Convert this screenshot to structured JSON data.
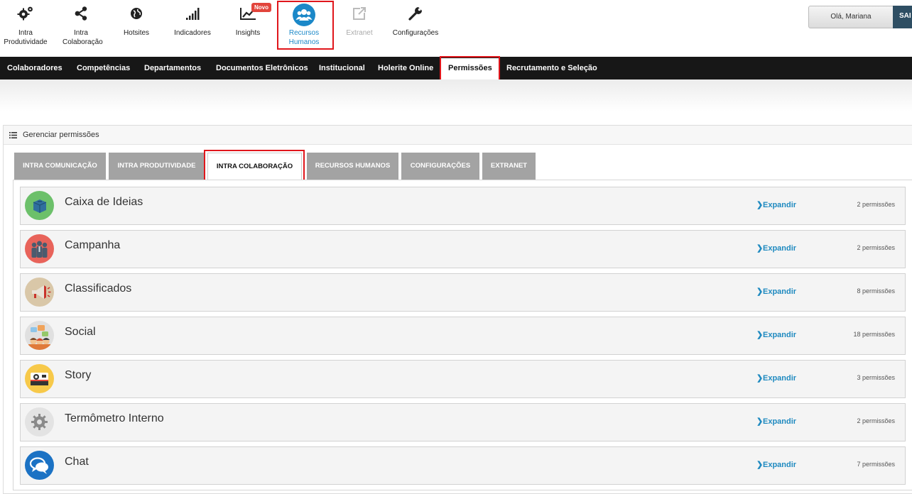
{
  "apps": [
    {
      "label": "Intra Produtividade",
      "icon": "gears-icon"
    },
    {
      "label": "Intra Colaboração",
      "icon": "share-icon"
    },
    {
      "label": "Hotsites",
      "icon": "globe-icon"
    },
    {
      "label": "Indicadores",
      "icon": "signal-bars-icon"
    },
    {
      "label": "Insights",
      "icon": "line-chart-icon",
      "badge": "Novo"
    },
    {
      "label": "Recursos Humanos",
      "icon": "people-icon"
    },
    {
      "label": "Extranet",
      "icon": "external-link-icon"
    },
    {
      "label": "Configurações",
      "icon": "wrench-icon"
    }
  ],
  "user": {
    "greeting": "Olá, Mariana",
    "logout": "SAI"
  },
  "subnav": [
    "Colaboradores",
    "Competências",
    "Departamentos",
    "Documentos Eletrônicos",
    "Institucional",
    "Holerite Online",
    "Permissões",
    "Recrutamento e Seleção"
  ],
  "panel": {
    "title": "Gerenciar permissões"
  },
  "tabs": [
    "INTRA COMUNICAÇÃO",
    "INTRA PRODUTIVIDADE",
    "INTRA COLABORAÇÃO",
    "RECURSOS HUMANOS",
    "CONFIGURAÇÕES",
    "EXTRANET"
  ],
  "modules": [
    {
      "name": "Caixa de Ideias",
      "expand": "Expandir",
      "count": "2 permissões",
      "icon": "idea-box-icon"
    },
    {
      "name": "Campanha",
      "expand": "Expandir",
      "count": "2 permissões",
      "icon": "campaign-icon"
    },
    {
      "name": "Classificados",
      "expand": "Expandir",
      "count": "8 permissões",
      "icon": "megaphone-icon"
    },
    {
      "name": "Social",
      "expand": "Expandir",
      "count": "18 permissões",
      "icon": "social-icon"
    },
    {
      "name": "Story",
      "expand": "Expandir",
      "count": "3 permissões",
      "icon": "camera-icon"
    },
    {
      "name": "Termômetro Interno",
      "expand": "Expandir",
      "count": "2 permissões",
      "icon": "gear-icon"
    },
    {
      "name": "Chat",
      "expand": "Expandir",
      "count": "7 permissões",
      "icon": "chat-icon"
    }
  ],
  "colors": {
    "accent": "#1b88c8",
    "highlight": "#e0161b",
    "subnav_bg": "#171717",
    "tab_bg": "#a3a3a3"
  }
}
